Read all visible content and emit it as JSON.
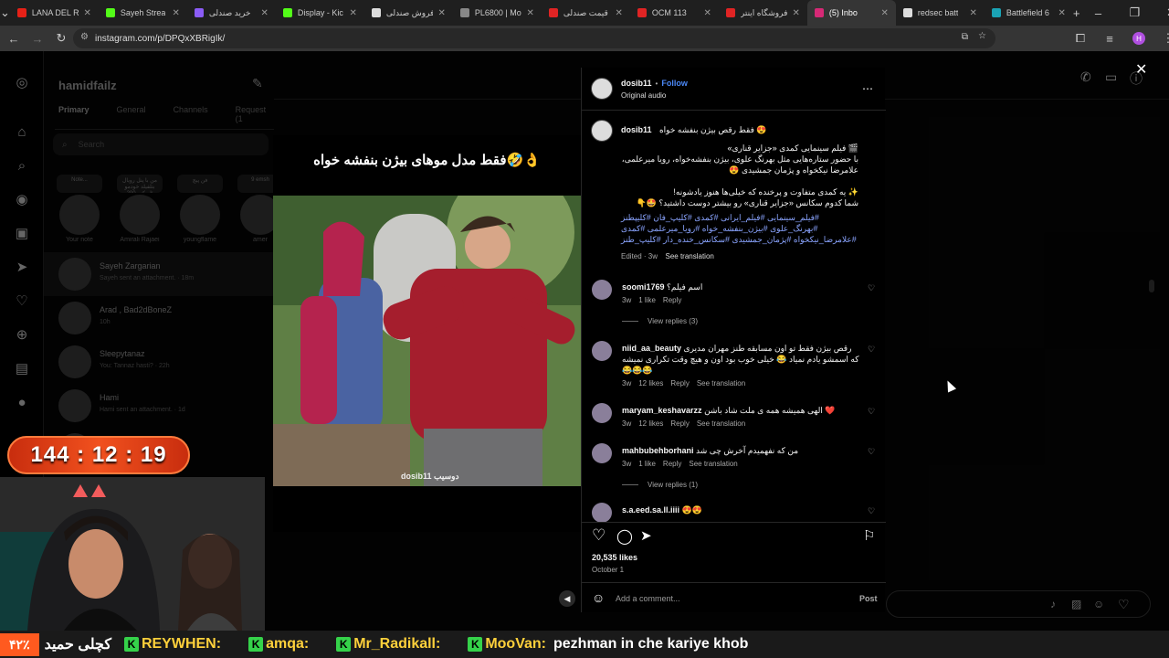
{
  "browser": {
    "tabs": [
      {
        "label": "LANA DEL R",
        "color": "#e62117"
      },
      {
        "label": "Sayeh Strea",
        "color": "#53fc18"
      },
      {
        "label": "خرید صندلی",
        "color": "#8b5cf6"
      },
      {
        "label": "Display - Kic",
        "color": "#53fc18"
      },
      {
        "label": "فروش صندلی",
        "color": "#dddddd"
      },
      {
        "label": "PL6800 | Mo",
        "color": "#888888"
      },
      {
        "label": "قیمت صندلی",
        "color": "#e02424"
      },
      {
        "label": "OCM 113",
        "color": "#e02424"
      },
      {
        "label": "فروشگاه اینتر",
        "color": "#e02424"
      },
      {
        "label": "(5) Inbo",
        "color": "#d62976",
        "active": true
      },
      {
        "label": "redsec batt",
        "color": "#dddddd"
      },
      {
        "label": "Battlefield 6",
        "color": "#1aa3b5"
      }
    ],
    "url": "instagram.com/p/DPQxXBRigIk/",
    "profile_initial": "H"
  },
  "inbox": {
    "account": "hamidfailz",
    "tabs": [
      "Primary",
      "General",
      "Channels",
      "Request (1"
    ],
    "search_placeholder": "Search",
    "notes": [
      {
        "note": "Note...",
        "name": "Your note"
      },
      {
        "note": "من با پنل رویال بتلفیلد خودمو میکنم 200k",
        "name": "Amirali Rajaei"
      },
      {
        "note": "فن پیچ",
        "name": "youngflame"
      },
      {
        "note": "9 emsh",
        "name": "amer"
      }
    ],
    "threads": [
      {
        "name": "Sayeh Zargarian",
        "preview": "Sayeh sent an attachment. · 18m"
      },
      {
        "name": "Arad , Bad2dBoneZ",
        "preview": "10h"
      },
      {
        "name": "Sleepytanaz",
        "preview": "You: Tannaz hasti? · 22h"
      },
      {
        "name": "Hami",
        "preview": "Hami sent an attachment. · 1d"
      },
      {
        "name": "",
        "preview": "1d"
      }
    ]
  },
  "reel": {
    "caption": "فقط مدل موهای بیژن بنفشه خواه🤣👌",
    "watermark": "dosib11 دوسیب"
  },
  "post": {
    "username": "dosib11",
    "follow": "Follow",
    "audio": "Original audio",
    "caption_title": "فقط رقص بیژن بنفشه خواه 😍",
    "caption_lines": [
      "🎬 فیلم سینمایی کمدی «جزایر قناری»",
      "با حضور ستاره‌هایی مثل بهرنگ علوی، بیژن بنفشه‌خواه، رویا میرعلمی،",
      "علامرضا نیکخواه و پژمان جمشیدی 😍",
      "",
      "✨ یه کمدی متفاوت و پرخنده که خیلی‌ها هنوز یادشونه!",
      "شما کدوم سکانس «جزایر قناری» رو بیشتر دوست داشتید؟ 🤩👇"
    ],
    "hashtags": [
      "#فیلم_سینمایی #فیلم_ایرانی #کمدی #کلیپ_فان #کلیپطنز",
      "#بهرنگ_علوی #بیژن_بنفشه_خواه #رویا_میرعلمی #کمدی",
      "#علامرضا_نیکخواه #پژمان_جمشیدی #سکانس_خنده_دار #کلیپ_طنز"
    ],
    "caption_meta": "Edited · 3w",
    "see_translation": "See translation",
    "comments": [
      {
        "user": "soomi1769",
        "text": "اسم فیلم؟",
        "age": "3w",
        "likes": "1 like",
        "reply": "Reply",
        "translate": "",
        "view_replies": "View replies (3)"
      },
      {
        "user": "niid_aa_beauty",
        "text": "رقص بیژن فقط تو اون مسابقه طنز مهران مدیری که اسمشو یادم نمیاد 😂 خیلی خوب بود اون و هیچ وقت تکراری نمیشه 😂😂😂",
        "age": "3w",
        "likes": "12 likes",
        "reply": "Reply",
        "translate": "See translation",
        "view_replies": ""
      },
      {
        "user": "maryam_keshavarzz",
        "text": "الهی همیشه همه ی ملت شاد باشن ❤️",
        "age": "3w",
        "likes": "12 likes",
        "reply": "Reply",
        "translate": "See translation",
        "view_replies": ""
      },
      {
        "user": "mahbubehborhani",
        "text": "من که نفهمیدم آخرش چی شد",
        "age": "3w",
        "likes": "1 like",
        "reply": "Reply",
        "translate": "See translation",
        "view_replies": "View replies (1)"
      },
      {
        "user": "s.a.eed.sa.ll.iiii",
        "text": "😍😍",
        "age": "",
        "likes": "",
        "reply": "",
        "translate": "",
        "view_replies": ""
      }
    ],
    "likes": "20,535 likes",
    "date": "October 1",
    "add_comment_placeholder": "Add a comment...",
    "post_button": "Post"
  },
  "stream": {
    "timer": "144 : 12 : 19",
    "ticker": {
      "percent": "۴۲٪",
      "left_text": "کچلی حمید",
      "chat": [
        {
          "user": "REYWHEN:",
          "msg": ""
        },
        {
          "user": "amqa:",
          "msg": ""
        },
        {
          "user": "Mr_Radikall:",
          "msg": ""
        },
        {
          "user": "MooVan:",
          "msg": "pezhman in che kariye khob"
        }
      ]
    }
  }
}
